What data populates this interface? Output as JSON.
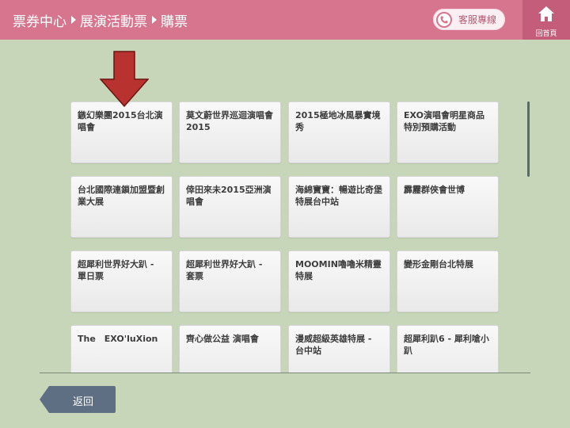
{
  "header": {
    "breadcrumb": [
      "票券中心",
      "展演活動票",
      "購票"
    ],
    "service_label": "客服專線",
    "home_label": "回首頁"
  },
  "events": [
    "鏃幻樂團2015台北演唱會",
    "莫文蔚世界巡迴演唱會2015",
    "2015極地冰風暴實境秀",
    "EXO演唱會明星商品特別預購活動",
    "台北國際連鎖加盟暨創業大展",
    "倖田來未2015亞洲演唱會",
    "海綿寶寶：暢遊比奇堡特展台中站",
    "霹靂群俠會世博",
    "超犀利世界好大趴 - 單日票",
    "超犀利世界好大趴 - 套票",
    "MOOMIN嚕嚕米精靈特展",
    "變形金剛台北特展",
    "The　EXO'luXion",
    "齊心做公益 演唱會",
    "漫威超級英雄特展 - 台中站",
    "超犀利趴6 - 犀利嗆小趴"
  ],
  "footer": {
    "back_label": "返回"
  },
  "colors": {
    "header": "#d7758f",
    "home": "#c35d79",
    "background": "#c7d6b9",
    "arrow": "#b8322f",
    "back_button": "#5e6f84"
  }
}
